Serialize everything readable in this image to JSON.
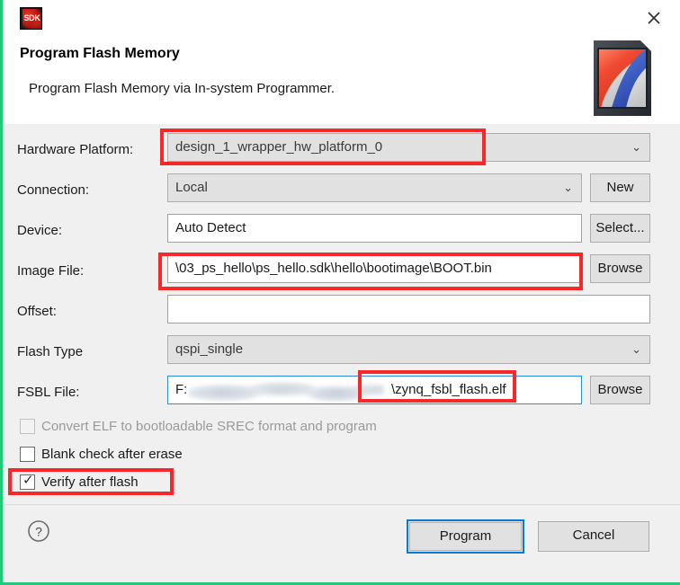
{
  "window": {
    "icon_name": "sdk-icon",
    "icon_text": "SDK",
    "close_label": "✕",
    "edge_color": "#21c97a"
  },
  "header": {
    "title": "Program Flash Memory",
    "subtitle": "Program Flash Memory via In-system Programmer.",
    "banner_icon_name": "flash-card-icon"
  },
  "form": {
    "hardware_platform": {
      "label": "Hardware Platform:",
      "value": "design_1_wrapper_hw_platform_0",
      "control": "combo",
      "chevron": "⌄"
    },
    "connection": {
      "label": "Connection:",
      "value": "Local",
      "control": "combo",
      "chevron": "⌄",
      "button": "New"
    },
    "device": {
      "label": "Device:",
      "value": "Auto Detect",
      "control": "textfield",
      "button": "Select..."
    },
    "image_file": {
      "label": "Image File:",
      "value": "\\03_ps_hello\\ps_hello.sdk\\hello\\bootimage\\BOOT.bin",
      "control": "textfield",
      "button": "Browse"
    },
    "offset": {
      "label": "Offset:",
      "value": "",
      "placeholder": "",
      "control": "textfield"
    },
    "flash_type": {
      "label": "Flash Type",
      "value": "qspi_single",
      "control": "combo",
      "chevron": "⌄"
    },
    "fsbl_file": {
      "label": "FSBL File:",
      "value_prefix": "F:",
      "value_redacted": "",
      "value_suffix": "\\zynq_fsbl_flash.elf",
      "control": "textfield",
      "focused": true,
      "button": "Browse"
    }
  },
  "checkboxes": [
    {
      "label": "Convert ELF to bootloadable SREC format and program",
      "checked": false,
      "disabled": true,
      "tick": ""
    },
    {
      "label": "Blank check after erase",
      "checked": false,
      "disabled": false,
      "tick": ""
    },
    {
      "label": "Verify after flash",
      "checked": true,
      "disabled": false,
      "tick": "✓"
    }
  ],
  "footer": {
    "help_icon_name": "help-icon",
    "help_glyph": "?",
    "program_button": "Program",
    "cancel_button": "Cancel"
  },
  "annotations": {
    "color": "#f8272a",
    "boxes": [
      "hardware-platform-value",
      "image-file-value",
      "fsbl-file-suffix",
      "verify-after-flash-checkbox"
    ]
  }
}
